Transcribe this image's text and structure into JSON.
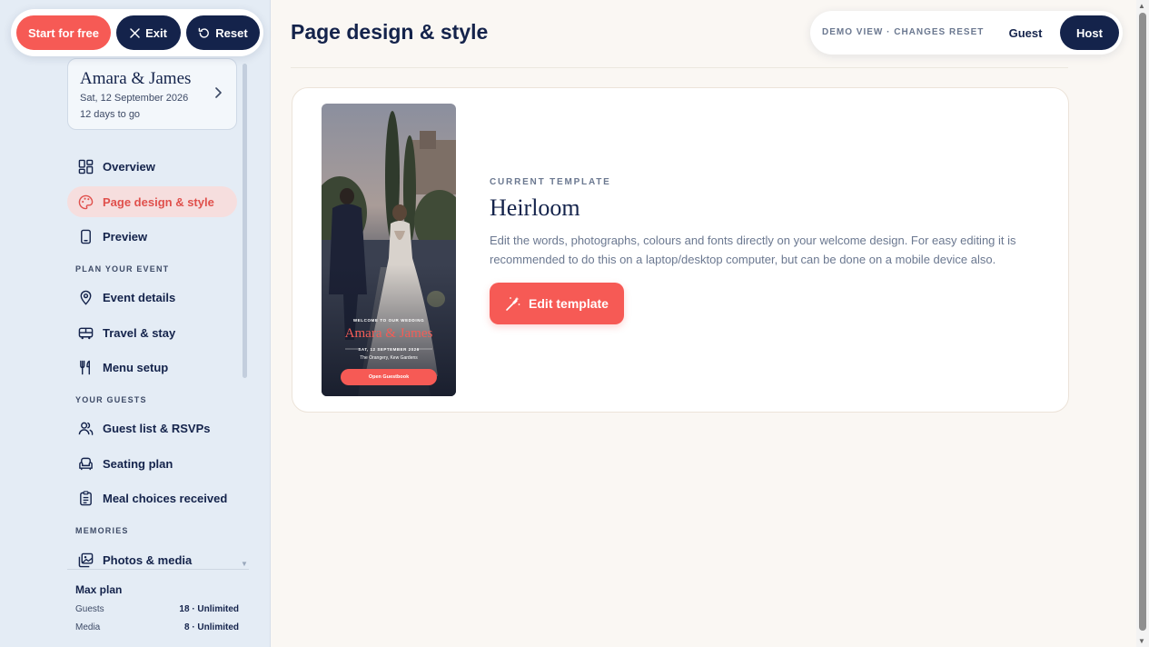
{
  "top_actions": {
    "start_label": "Start for free",
    "exit_label": "Exit",
    "reset_label": "Reset"
  },
  "couple": {
    "names": "Amara & James",
    "date": "Sat, 12 September 2026",
    "countdown": "12 days to go"
  },
  "sidebar": {
    "main_items": [
      {
        "label": "Overview",
        "icon": "grid-icon"
      },
      {
        "label": "Page design & style",
        "icon": "palette-icon",
        "active": true
      },
      {
        "label": "Preview",
        "icon": "phone-icon"
      }
    ],
    "plan_section": "PLAN YOUR EVENT",
    "plan_items": [
      {
        "label": "Event details",
        "icon": "location-pin-icon"
      },
      {
        "label": "Travel & stay",
        "icon": "bus-icon"
      },
      {
        "label": "Menu setup",
        "icon": "cutlery-icon"
      }
    ],
    "guests_section": "YOUR GUESTS",
    "guest_items": [
      {
        "label": "Guest list & RSVPs",
        "icon": "users-icon"
      },
      {
        "label": "Seating plan",
        "icon": "armchair-icon"
      },
      {
        "label": "Meal choices received",
        "icon": "clipboard-icon"
      }
    ],
    "memories_section": "MEMORIES",
    "memory_items": [
      {
        "label": "Photos & media",
        "icon": "images-icon"
      }
    ],
    "plan": {
      "title": "Max plan",
      "guests_label": "Guests",
      "guests_value": "18 · Unlimited",
      "media_label": "Media",
      "media_value": "8 · Unlimited"
    }
  },
  "header": {
    "title": "Page design & style",
    "demo_label": "DEMO VIEW · CHANGES RESET",
    "guest_label": "Guest",
    "host_label": "Host"
  },
  "template": {
    "section_label": "CURRENT TEMPLATE",
    "name": "Heirloom",
    "description": "Edit the words, photographs, colours and fonts directly on your welcome design. For easy editing it is recommended to do this on a laptop/desktop computer, but can be done on a mobile device also.",
    "edit_label": "Edit template",
    "preview": {
      "welcome": "WELCOME TO OUR WEDDING",
      "names": "Amara & James",
      "date": "SAT, 12 SEPTEMBER 2026",
      "venue": "The Orangery, Kew Gardens",
      "button": "Open Guestbook"
    }
  },
  "colors": {
    "accent": "#f65a55",
    "navy": "#14234b",
    "sidebar_bg": "#e4ecf5",
    "page_bg": "#faf7f3"
  }
}
